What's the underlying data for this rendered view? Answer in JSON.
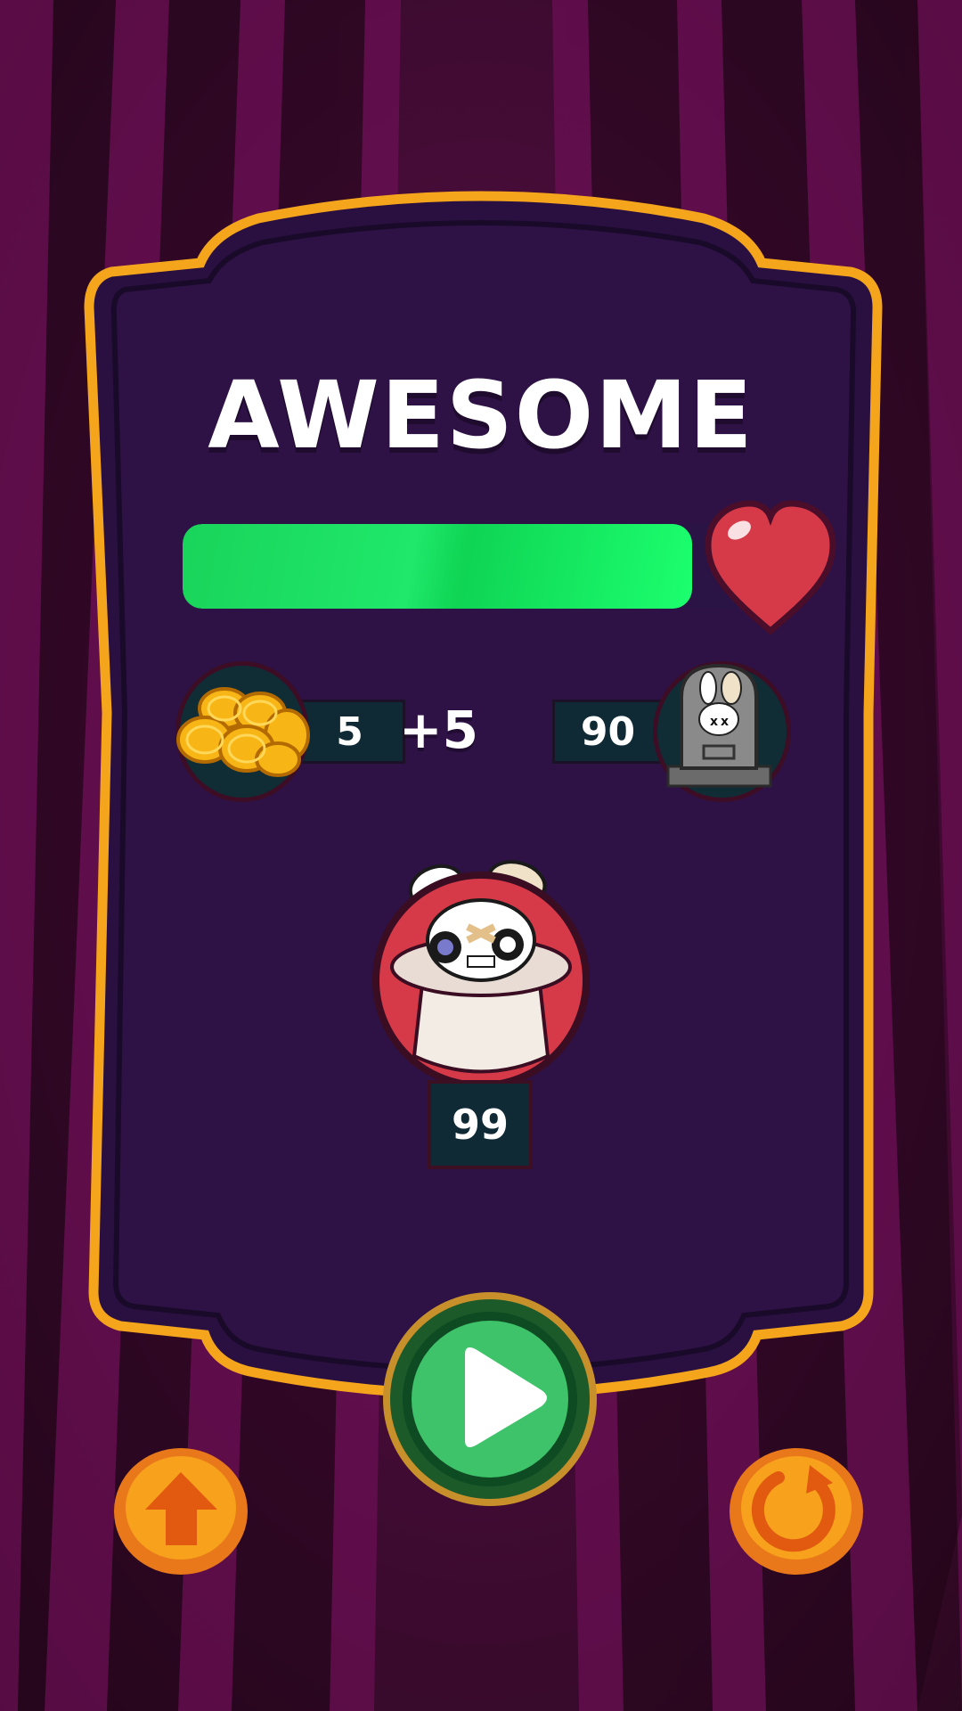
{
  "screen": {
    "title": "AWESOME",
    "health_level": 0.88
  },
  "coins": {
    "icon": "coins-icon",
    "value": "5",
    "bonus": "+5"
  },
  "kills": {
    "icon": "tombstone-icon",
    "value": "90"
  },
  "character": {
    "icon": "mushroom-bunny-character",
    "count": "99"
  },
  "buttons": {
    "play": "play-icon",
    "upgrade": "arrow-up-icon",
    "restart": "restart-icon"
  },
  "colors": {
    "panel_fill": "#2e1245",
    "panel_border": "#f5a51c",
    "health_green": "#1fe86a",
    "heart_red": "#d63a48",
    "orange_button": "#f7a11c",
    "green_button": "#3ec36a"
  }
}
